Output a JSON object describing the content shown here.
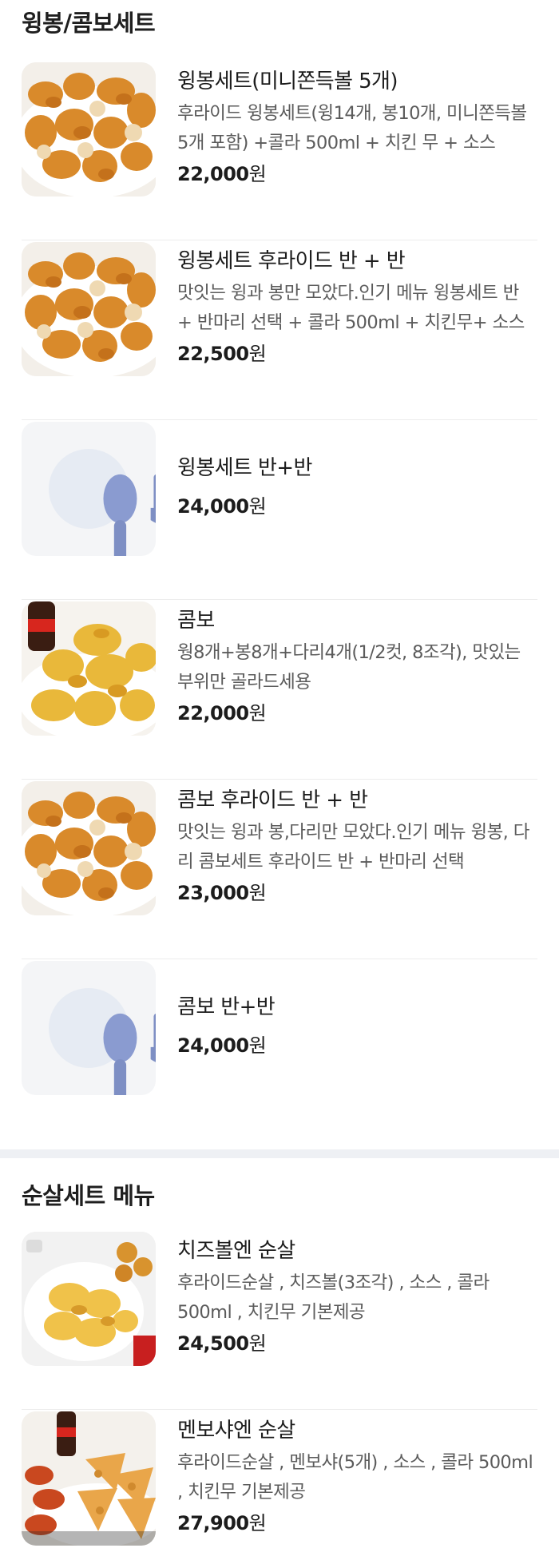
{
  "sections": [
    {
      "title": "윙봉/콤보세트",
      "items": [
        {
          "name": "윙봉세트(미니쫀득볼 5개)",
          "desc": "후라이드 윙봉세트(윙14개, 봉10개, 미니쫀득볼 5개 포함) +콜라 500ml + 치킨 무 + 소스",
          "price": "22,000",
          "image": "fried-wings-photo"
        },
        {
          "name": "윙봉세트 후라이드 반 + 반",
          "desc": "맛잇는 윙과 봉만 모았다.인기 메뉴 윙봉세트 반 + 반마리 선택 + 콜라 500ml + 치킨무+ 소스",
          "price": "22,500",
          "image": "fried-wings-photo"
        },
        {
          "name": "윙봉세트 반+반",
          "desc": "",
          "price": "24,000",
          "image": "placeholder-utensils"
        },
        {
          "name": "콤보",
          "desc": "웡8개+봉8개+다리4개(1/2컷, 8조각), 맛있는 부위만 골라드세용",
          "price": "22,000",
          "image": "combo-chicken-coke-photo"
        },
        {
          "name": "콤보 후라이드 반 + 반",
          "desc": "맛잇는 윙과 봉,다리만 모았다.인기 메뉴 윙봉, 다리 콤보세트 후라이드 반 + 반마리 선택",
          "price": "23,000",
          "image": "fried-wings-photo"
        },
        {
          "name": "콤보 반+반",
          "desc": "",
          "price": "24,000",
          "image": "placeholder-utensils"
        }
      ]
    },
    {
      "title": "순살세트 메뉴",
      "items": [
        {
          "name": "치즈볼엔 순살",
          "desc": "후라이드순살 , 치즈볼(3조각) , 소스 , 콜라 500ml , 치킨무 기본제공",
          "price": "24,500",
          "image": "boneless-cheeseball-photo"
        },
        {
          "name": "멘보샤엔 순살",
          "desc": "후라이드순살 , 멘보샤(5개) , 소스 , 콜라 500ml , 치킨무 기본제공",
          "price": "27,900",
          "image": "boneless-menbosha-photo"
        }
      ]
    }
  ],
  "currency_suffix": "원",
  "colors": {
    "price": "#1c1c1c",
    "desc": "#5b5b5b",
    "divider": "#eef0f4",
    "placeholder_bg": "#f4f5f7",
    "placeholder_icon": "#7e8fc4"
  }
}
